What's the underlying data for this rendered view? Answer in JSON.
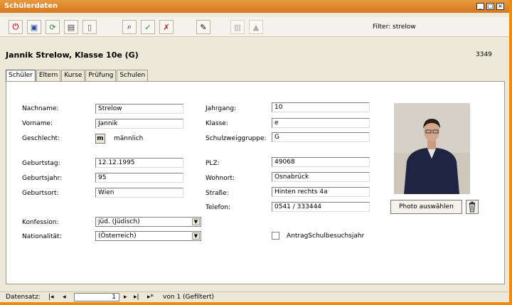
{
  "window": {
    "title": "Schülerdaten"
  },
  "toolbar": {
    "icons": [
      "exit-icon",
      "save-icon",
      "refresh-icon",
      "print-icon",
      "new-record-icon",
      "find-icon",
      "filter-icon",
      "remove-filter-icon",
      "edit-icon",
      "columns-icon",
      "up-icon"
    ],
    "filter_label": "Filter:",
    "filter_value": "strelow"
  },
  "header": {
    "name": "Jannik Strelow, Klasse 10e (G)",
    "id": "3349"
  },
  "tabs": [
    {
      "label": "Schüler",
      "active": true
    },
    {
      "label": "Eltern"
    },
    {
      "label": "Kurse"
    },
    {
      "label": "Prüfung"
    },
    {
      "label": "Schulen"
    }
  ],
  "form": {
    "nachname": {
      "label": "Nachname:",
      "value": "Strelow"
    },
    "vorname": {
      "label": "Vorname:",
      "value": "Jannik"
    },
    "geschlecht": {
      "label": "Geschlecht:",
      "button": "m",
      "value": "männlich"
    },
    "geburtstag": {
      "label": "Geburtstag:",
      "value": "12.12.1995"
    },
    "geburtsjahr": {
      "label": "Geburtsjahr:",
      "value": "95"
    },
    "geburtsort": {
      "label": "Geburtsort:",
      "value": "Wien"
    },
    "konfession": {
      "label": "Konfession:",
      "value": "jüd. (Jüdisch)"
    },
    "nationalitaet": {
      "label": "Nationalität:",
      "value": "(Österreich)"
    },
    "jahrgang": {
      "label": "Jahrgang:",
      "value": "10"
    },
    "klasse": {
      "label": "Klasse:",
      "value": "e"
    },
    "schulzweig": {
      "label": "Schulzweiggruppe:",
      "value": "G"
    },
    "plz": {
      "label": "PLZ:",
      "value": "49068"
    },
    "wohnort": {
      "label": "Wohnort:",
      "value": "Osnabrück"
    },
    "strasse": {
      "label": "Straße:",
      "value": "Hinten rechts 4a"
    },
    "telefon": {
      "label": "Telefon:",
      "value": "0541 / 333444"
    },
    "antrag": {
      "label": "AntragSchulbesuchsjahr",
      "checked": false
    }
  },
  "photo": {
    "button_label": "Photo auswählen"
  },
  "navbar": {
    "label": "Datensatz:",
    "current": "1",
    "total_text": "von 1 (Gefiltert)"
  }
}
